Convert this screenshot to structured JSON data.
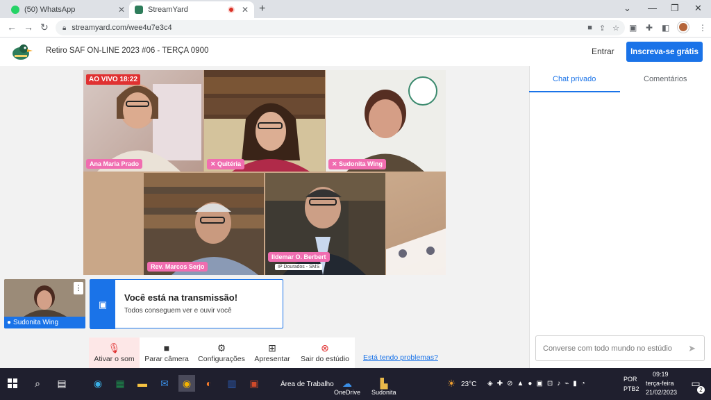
{
  "browser": {
    "tabs": [
      {
        "label": "(50) WhatsApp",
        "close": "✕"
      },
      {
        "label": "StreamYard",
        "close": "✕"
      }
    ],
    "new_tab": "+",
    "url": "streamyard.com/wee4u7e3c4"
  },
  "header": {
    "title": "Retiro SAF ON-LINE 2023 #06 - TERÇA 0900",
    "login": "Entrar",
    "signup": "Inscreva-se grátis"
  },
  "stage": {
    "live_badge": "AO VIVO 18:22",
    "participants": [
      {
        "name": "Ana Maria Prado"
      },
      {
        "name": "Quitéria"
      },
      {
        "name": "Sudonita Wing"
      },
      {
        "name": "Rev. Marcos Serjo"
      },
      {
        "name": "Ildemar O. Berbert",
        "subtitle": "IP Dourados - SMS"
      }
    ]
  },
  "self_preview": {
    "name": "Sudonita Wing",
    "menu": "⋮"
  },
  "notice": {
    "title": "Você está na transmissão!",
    "subtitle": "Todos conseguem ver e ouvir você"
  },
  "controls": [
    {
      "label": "Ativar o som",
      "icon": "mic-off-icon"
    },
    {
      "label": "Parar câmera",
      "icon": "camera-icon"
    },
    {
      "label": "Configurações",
      "icon": "gear-icon"
    },
    {
      "label": "Apresentar",
      "icon": "present-icon"
    },
    {
      "label": "Sair do estúdio",
      "icon": "leave-icon"
    }
  ],
  "problems_link": "Está tendo problemas?",
  "sidebar": {
    "tabs": [
      "Chat privado",
      "Comentários"
    ],
    "chat_placeholder": "Converse com todo mundo no estúdio"
  },
  "taskbar": {
    "desktop_label": "Área de Trabalho",
    "onedrive_label": "OneDrive",
    "sudonita_label": "Sudonita",
    "temperature": "23°C",
    "language": "POR",
    "layout": "PTB2",
    "time": "09:19",
    "day": "terça-feira",
    "date": "21/02/2023",
    "notifications": "2"
  },
  "colors": {
    "accent": "#1a73e8",
    "live": "#e03131",
    "nametag": "#f06db0"
  }
}
